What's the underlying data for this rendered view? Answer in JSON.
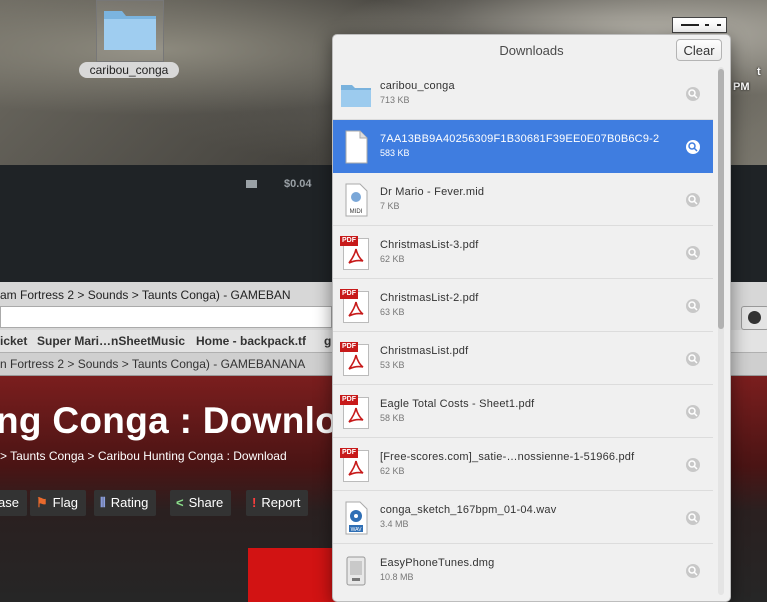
{
  "desktop": {
    "folder_label": "caribou_conga",
    "right_text": [
      "t",
      "PM",
      "t",
      "PM"
    ]
  },
  "steam": {
    "balance": "$0.04"
  },
  "browser": {
    "window_title": "am Fortress 2 > Sounds > Taunts Conga) - GAMEBAN",
    "bookmarks": [
      "icket",
      "Super Mari…nSheetMusic",
      "Home - backpack.tf",
      "g"
    ],
    "tab_title": "n Fortress 2 > Sounds > Taunts Conga) - GAMEBANANA"
  },
  "page": {
    "heading": "ng Conga : Downloa",
    "breadcrumbs": "> Taunts Conga > Caribou Hunting Conga : Download",
    "buttons": [
      {
        "label": "ase",
        "icon": ""
      },
      {
        "label": "Flag",
        "icon": "flag-icon"
      },
      {
        "label": "Rating",
        "icon": "rating-icon"
      },
      {
        "label": "Share",
        "icon": "share-icon"
      },
      {
        "label": "Report",
        "icon": "alert-icon"
      }
    ]
  },
  "downloads": {
    "title": "Downloads",
    "clear_label": "Clear",
    "items": [
      {
        "name": "caribou_conga",
        "size": "713 KB",
        "type": "folder"
      },
      {
        "name": "7AA13BB9A40256309F1B30681F39EE0E07B0B6C9-2",
        "size": "583 KB",
        "type": "doc"
      },
      {
        "name": "Dr Mario - Fever.mid",
        "size": "7 KB",
        "type": "midi"
      },
      {
        "name": "ChristmasList-3.pdf",
        "size": "62 KB",
        "type": "pdf"
      },
      {
        "name": "ChristmasList-2.pdf",
        "size": "63 KB",
        "type": "pdf"
      },
      {
        "name": "ChristmasList.pdf",
        "size": "53 KB",
        "type": "pdf"
      },
      {
        "name": "Eagle Total Costs - Sheet1.pdf",
        "size": "58 KB",
        "type": "pdf"
      },
      {
        "name": "[Free-scores.com]_satie-…nossienne-1-51966.pdf",
        "size": "62 KB",
        "type": "pdf"
      },
      {
        "name": "conga_sketch_167bpm_01-04.wav",
        "size": "3.4 MB",
        "type": "wav"
      },
      {
        "name": "EasyPhoneTunes.dmg",
        "size": "10.8 MB",
        "type": "dmg"
      }
    ],
    "icon_text": {
      "midi": "MIDI",
      "pdf": "PDF",
      "wav": "WAV"
    }
  }
}
